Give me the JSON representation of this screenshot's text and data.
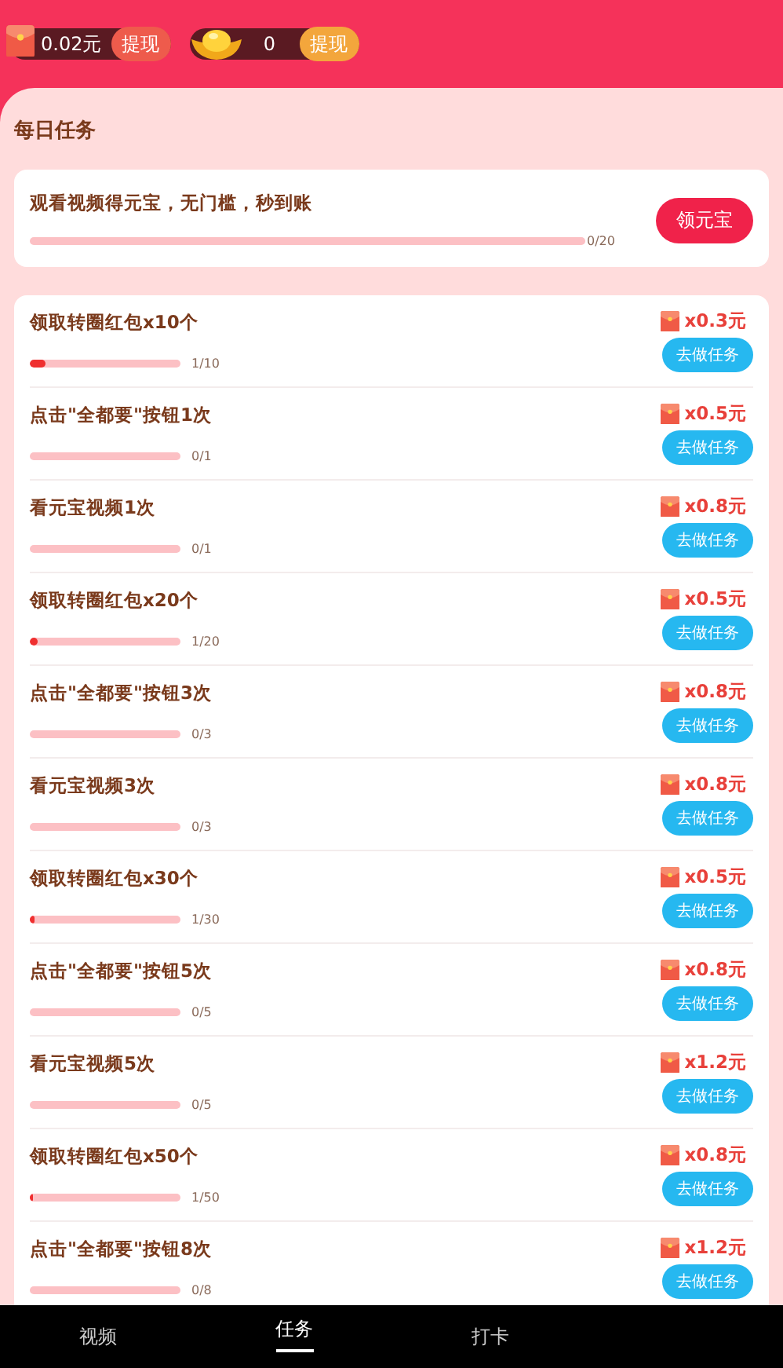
{
  "header": {
    "cash": {
      "amount": "0.02元",
      "button": "提现"
    },
    "ingots": {
      "amount": "0",
      "button": "提现"
    }
  },
  "section_title": "每日任务",
  "video_task": {
    "title": "观看视频得元宝，无门槛，秒到账",
    "reading": "0/20",
    "button": "领元宝"
  },
  "tasks": [
    {
      "title": "领取转圈红包x10个",
      "level": 0.1,
      "reading": "1/10",
      "reward": "x0.3元",
      "button": "去做任务"
    },
    {
      "title": "点击\"全都要\"按钮1次",
      "reading": "0/1",
      "reward": "x0.5元",
      "button": "去做任务"
    },
    {
      "title": "看元宝视频1次",
      "reading": "0/1",
      "reward": "x0.8元",
      "button": "去做任务"
    },
    {
      "title": "领取转圈红包x20个",
      "level": 0.05,
      "reading": "1/20",
      "reward": "x0.5元",
      "button": "去做任务"
    },
    {
      "title": "点击\"全都要\"按钮3次",
      "reading": "0/3",
      "reward": "x0.8元",
      "button": "去做任务"
    },
    {
      "title": "看元宝视频3次",
      "reading": "0/3",
      "reward": "x0.8元",
      "button": "去做任务"
    },
    {
      "title": "领取转圈红包x30个",
      "level": 0.033,
      "reading": "1/30",
      "reward": "x0.5元",
      "button": "去做任务"
    },
    {
      "title": "点击\"全都要\"按钮5次",
      "reading": "0/5",
      "reward": "x0.8元",
      "button": "去做任务"
    },
    {
      "title": "看元宝视频5次",
      "reading": "0/5",
      "reward": "x1.2元",
      "button": "去做任务"
    },
    {
      "title": "领取转圈红包x50个",
      "level": 0.02,
      "reading": "1/50",
      "reward": "x0.8元",
      "button": "去做任务"
    },
    {
      "title": "点击\"全都要\"按钮8次",
      "reading": "0/8",
      "reward": "x1.2元",
      "button": "去做任务"
    }
  ],
  "bottom_nav": [
    {
      "label": "视频",
      "selected": false
    },
    {
      "label": "任务",
      "selected": true
    },
    {
      "label": "打卡",
      "selected": false
    }
  ]
}
